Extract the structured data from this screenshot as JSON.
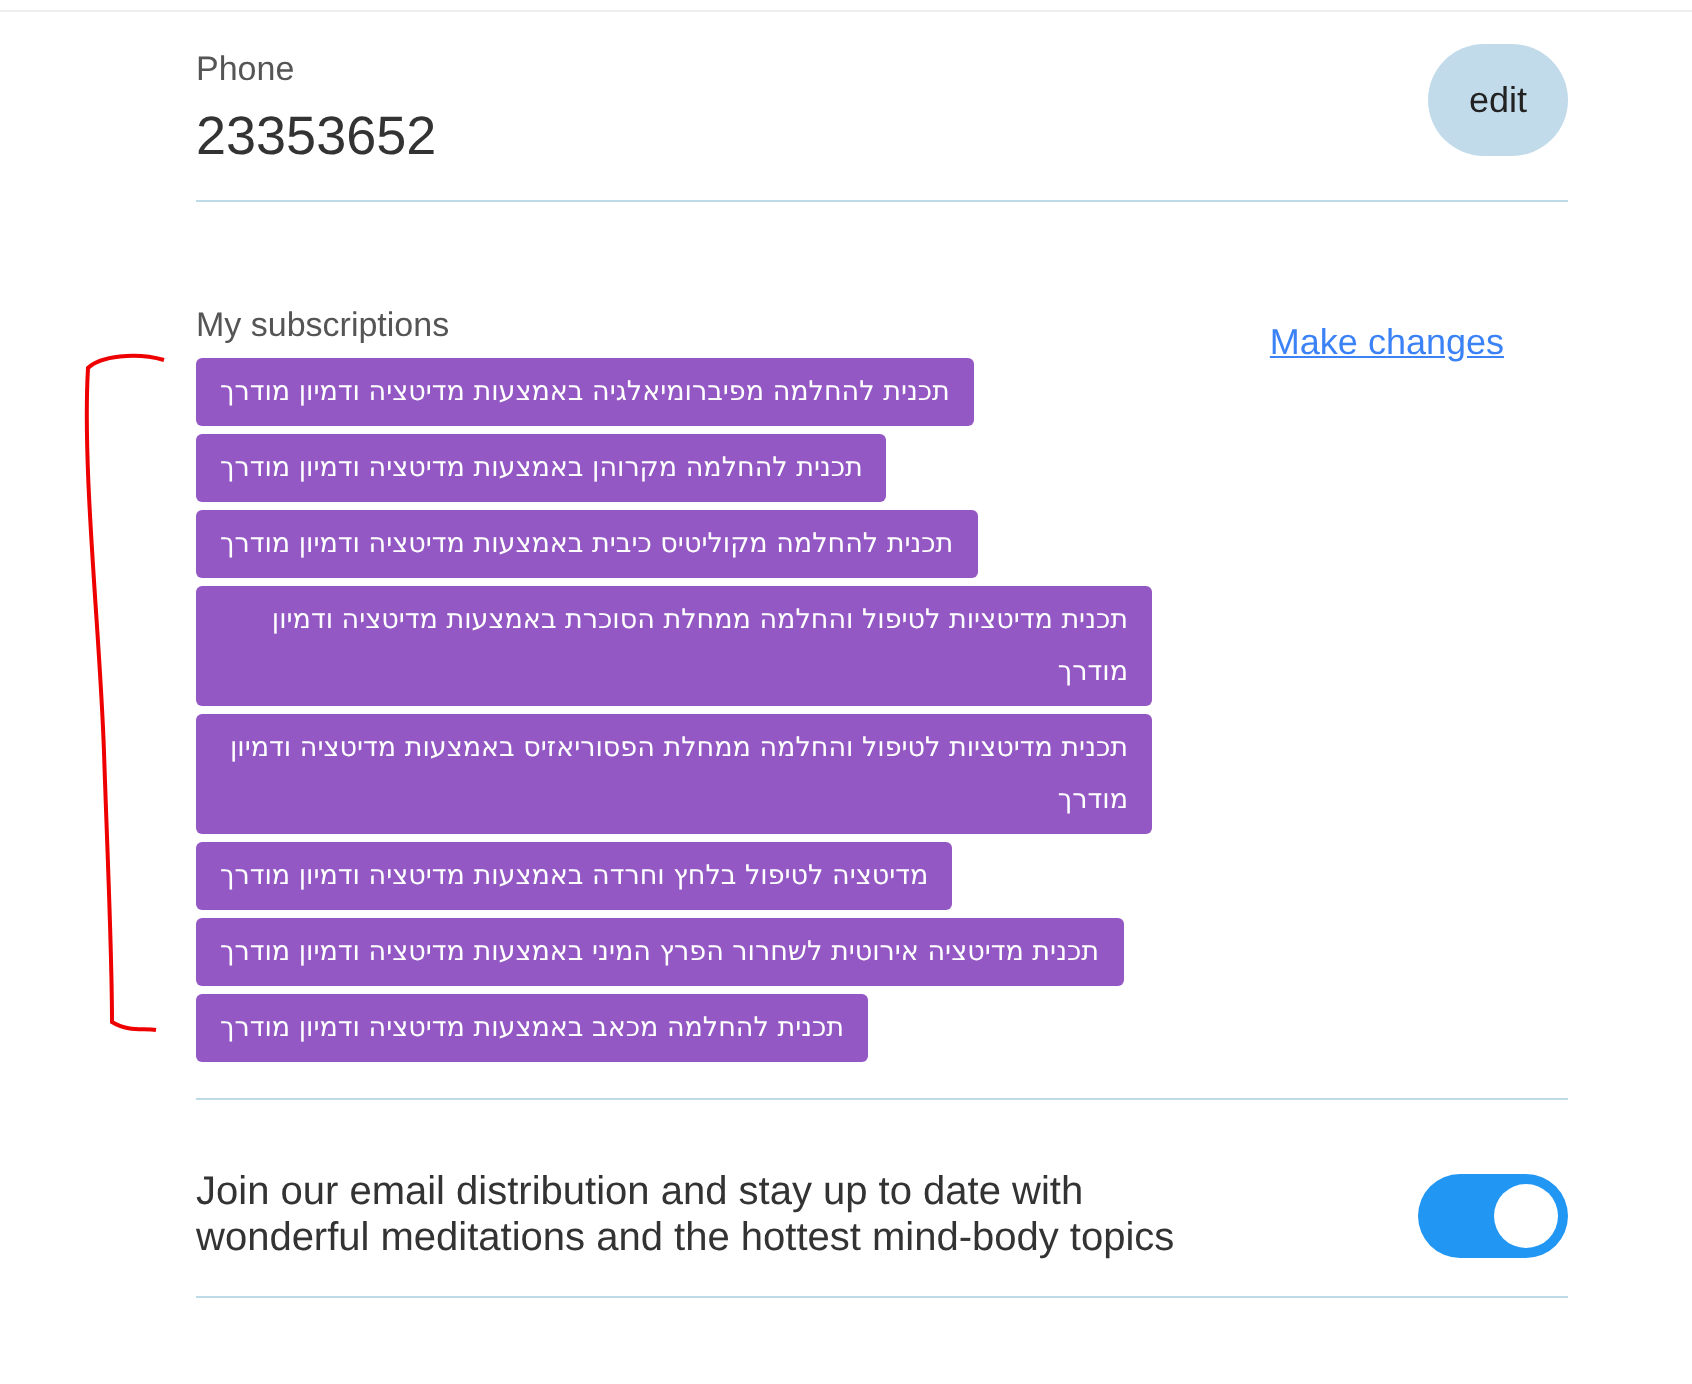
{
  "phone": {
    "label": "Phone",
    "value": "23353652",
    "edit_button": "edit"
  },
  "subscriptions": {
    "heading": "My subscriptions",
    "make_changes_link": "Make changes",
    "tags": [
      "תכנית להחלמה מפיברומיאלגיה באמצעות מדיטציה ודמיון מודרך",
      "תכנית להחלמה מקרוהן באמצעות מדיטציה ודמיון מודרך",
      "תכנית להחלמה מקוליטיס כיבית באמצעות מדיטציה ודמיון מודרך",
      "תכנית מדיטציות לטיפול והחלמה ממחלת הסוכרת באמצעות מדיטציה ודמיון מודרך",
      "תכנית מדיטציות לטיפול והחלמה ממחלת הפסוריאזיס באמצעות מדיטציה ודמיון מודרך",
      "מדיטציה לטיפול בלחץ וחרדה באמצעות מדיטציה ודמיון מודרך",
      "תכנית מדיטציה אירוטית לשחרור הפרץ המיני באמצעות מדיטציה ודמיון מודרך",
      "תכנית להחלמה מכאב באמצעות מדיטציה ודמיון מודרך"
    ]
  },
  "newsletter": {
    "text": "Join our email distribution and stay up to date with wonderful meditations and the hottest mind-body topics",
    "on": true
  }
}
